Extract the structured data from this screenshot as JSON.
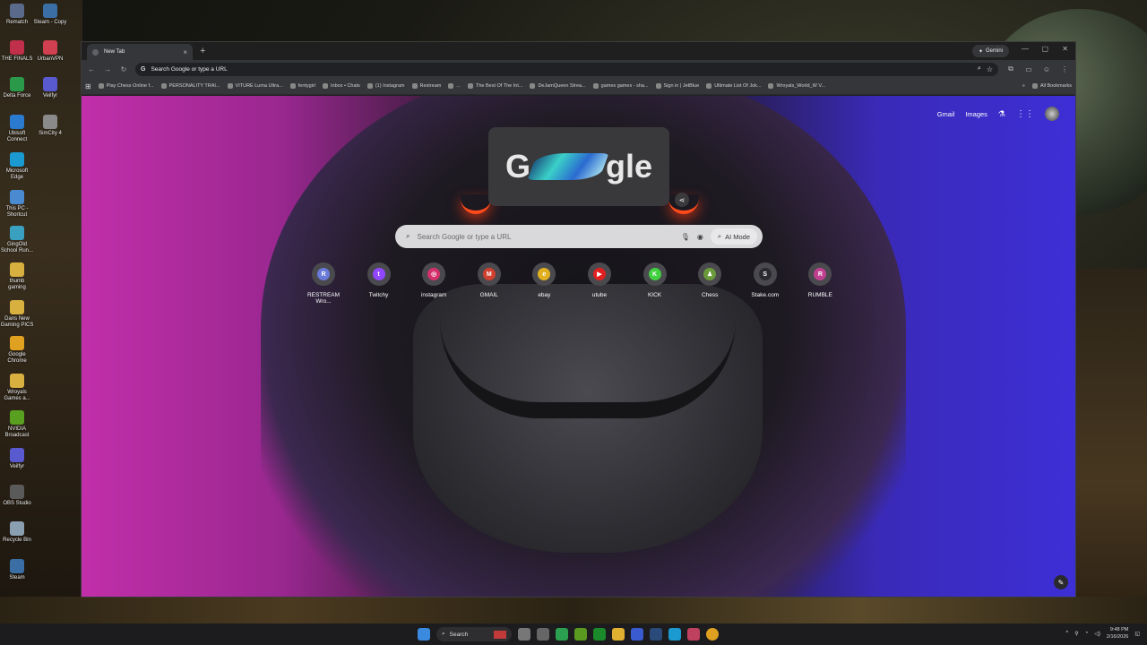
{
  "desktop_icons": [
    {
      "label": "Rematch",
      "color": "#5a6a8a"
    },
    {
      "label": "Steam - Copy",
      "color": "#3a6ea5"
    },
    {
      "label": "THE FINALS",
      "color": "#c0304a"
    },
    {
      "label": "UrbanVPN",
      "color": "#d04050"
    },
    {
      "label": "Delta Force",
      "color": "#2a9a4a"
    },
    {
      "label": "Veilfyr",
      "color": "#5a5ad0"
    },
    {
      "label": "Ubisoft Connect",
      "color": "#2a7ad0"
    },
    {
      "label": "SimCity 4",
      "color": "#8a8a8a"
    },
    {
      "label": "Microsoft Edge",
      "color": "#1a9ad0"
    },
    {
      "label": "This PC - Shortcut",
      "color": "#4a8ad0"
    },
    {
      "label": "GingOld School Run...",
      "color": "#3aa0c0"
    },
    {
      "label": "thumb gaming",
      "color": "#d8b040"
    },
    {
      "label": "Dans New Gaming PICS",
      "color": "#d8b040"
    },
    {
      "label": "Google Chrome",
      "color": "#e0a020"
    },
    {
      "label": "Wroyals Games a...",
      "color": "#d8b040"
    },
    {
      "label": "NVIDIA Broadcast",
      "color": "#5aa020"
    },
    {
      "label": "Veilfyr",
      "color": "#5a5ad0"
    },
    {
      "label": "OBS Studio",
      "color": "#5a5a5a"
    },
    {
      "label": "Recycle Bin",
      "color": "#8aa0b0"
    },
    {
      "label": "Steam",
      "color": "#3a6ea5"
    }
  ],
  "browser": {
    "tab_title": "New Tab",
    "new_tab_symbol": "+",
    "gemini_label": "Gemini",
    "omnibox_placeholder": "Search Google or type a URL",
    "bookmarks": [
      "Play Chess Online f...",
      "PERSONALITY TRAI...",
      "VITURE Luma Ultra...",
      "fentygirl",
      "Inbox • Chats",
      "(1) Instagram",
      "Restream",
      "...",
      "The Best Of The Int...",
      "DeJamQueen Strea...",
      "games games - sha...",
      "Sign in | JetBlue",
      "Ultimate List Of Jok...",
      "Wroyals_World_W V..."
    ],
    "bookmarks_more": "»",
    "all_bookmarks": "All Bookmarks"
  },
  "newtab": {
    "gmail": "Gmail",
    "images": "Images",
    "doodle_left": "G",
    "doodle_right": "gle",
    "search_placeholder": "Search Google or type a URL",
    "ai_mode": "AI Mode",
    "shortcuts": [
      {
        "label": "RESTREAM Wro...",
        "letter": "R",
        "color": "#6a7ad8"
      },
      {
        "label": "Twitchy",
        "letter": "t",
        "color": "#9146ff"
      },
      {
        "label": "instagram",
        "letter": "◎",
        "color": "#d6306a"
      },
      {
        "label": "GMAIL",
        "letter": "M",
        "color": "#d04030"
      },
      {
        "label": "ebay",
        "letter": "e",
        "color": "#e0b020"
      },
      {
        "label": "utube",
        "letter": "▶",
        "color": "#e02020"
      },
      {
        "label": "KICK",
        "letter": "K",
        "color": "#40d040"
      },
      {
        "label": "Chess",
        "letter": "♟",
        "color": "#6a9a3a"
      },
      {
        "label": "Stake.com",
        "letter": "S",
        "color": "#2a2a30"
      },
      {
        "label": "RUMBLE",
        "letter": "R",
        "color": "#c04090"
      }
    ]
  },
  "taskbar": {
    "search_label": "Search",
    "time": "9:48 PM",
    "date": "2/16/2026"
  }
}
